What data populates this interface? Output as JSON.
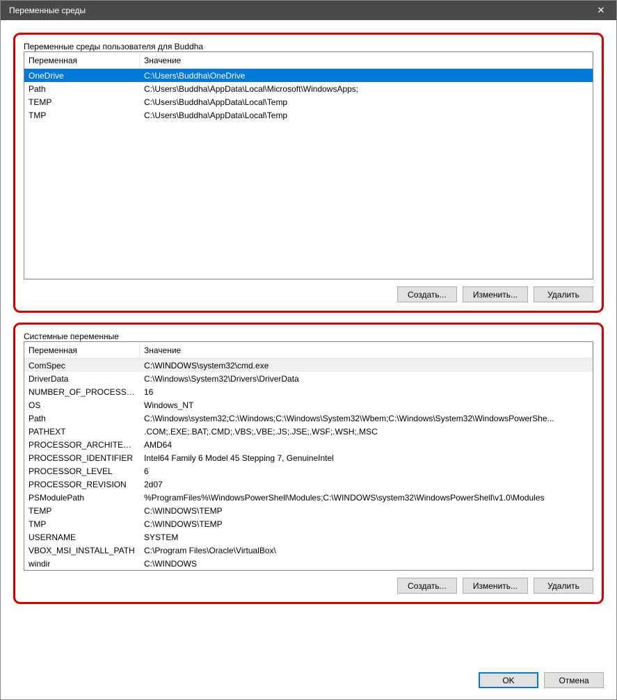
{
  "window": {
    "title": "Переменные среды"
  },
  "user_group": {
    "legend": "Переменные среды пользователя для Buddha",
    "columns": {
      "name": "Переменная",
      "value": "Значение"
    },
    "rows": [
      {
        "name": "OneDrive",
        "value": "C:\\Users\\Buddha\\OneDrive",
        "selected": true
      },
      {
        "name": "Path",
        "value": "C:\\Users\\Buddha\\AppData\\Local\\Microsoft\\WindowsApps;"
      },
      {
        "name": "TEMP",
        "value": "C:\\Users\\Buddha\\AppData\\Local\\Temp"
      },
      {
        "name": "TMP",
        "value": "C:\\Users\\Buddha\\AppData\\Local\\Temp"
      }
    ],
    "buttons": {
      "new": "Создать...",
      "edit": "Изменить...",
      "delete": "Удалить"
    }
  },
  "system_group": {
    "legend": "Системные переменные",
    "columns": {
      "name": "Переменная",
      "value": "Значение"
    },
    "rows": [
      {
        "name": "ComSpec",
        "value": "C:\\WINDOWS\\system32\\cmd.exe",
        "inactive": true
      },
      {
        "name": "DriverData",
        "value": "C:\\Windows\\System32\\Drivers\\DriverData"
      },
      {
        "name": "NUMBER_OF_PROCESSORS",
        "value": "16"
      },
      {
        "name": "OS",
        "value": "Windows_NT"
      },
      {
        "name": "Path",
        "value": "C:\\Windows\\system32;C:\\Windows;C:\\Windows\\System32\\Wbem;C:\\Windows\\System32\\WindowsPowerShe..."
      },
      {
        "name": "PATHEXT",
        "value": ".COM;.EXE;.BAT;.CMD;.VBS;.VBE;.JS;.JSE;.WSF;.WSH;.MSC"
      },
      {
        "name": "PROCESSOR_ARCHITECTURE",
        "value": "AMD64"
      },
      {
        "name": "PROCESSOR_IDENTIFIER",
        "value": "Intel64 Family 6 Model 45 Stepping 7, GenuineIntel"
      },
      {
        "name": "PROCESSOR_LEVEL",
        "value": "6"
      },
      {
        "name": "PROCESSOR_REVISION",
        "value": "2d07"
      },
      {
        "name": "PSModulePath",
        "value": "%ProgramFiles%\\WindowsPowerShell\\Modules;C:\\WINDOWS\\system32\\WindowsPowerShell\\v1.0\\Modules"
      },
      {
        "name": "TEMP",
        "value": "C:\\WINDOWS\\TEMP"
      },
      {
        "name": "TMP",
        "value": "C:\\WINDOWS\\TEMP"
      },
      {
        "name": "USERNAME",
        "value": "SYSTEM"
      },
      {
        "name": "VBOX_MSI_INSTALL_PATH",
        "value": "C:\\Program Files\\Oracle\\VirtualBox\\"
      },
      {
        "name": "windir",
        "value": "C:\\WINDOWS"
      }
    ],
    "buttons": {
      "new": "Создать...",
      "edit": "Изменить...",
      "delete": "Удалить"
    }
  },
  "footer": {
    "ok": "OK",
    "cancel": "Отмена"
  }
}
